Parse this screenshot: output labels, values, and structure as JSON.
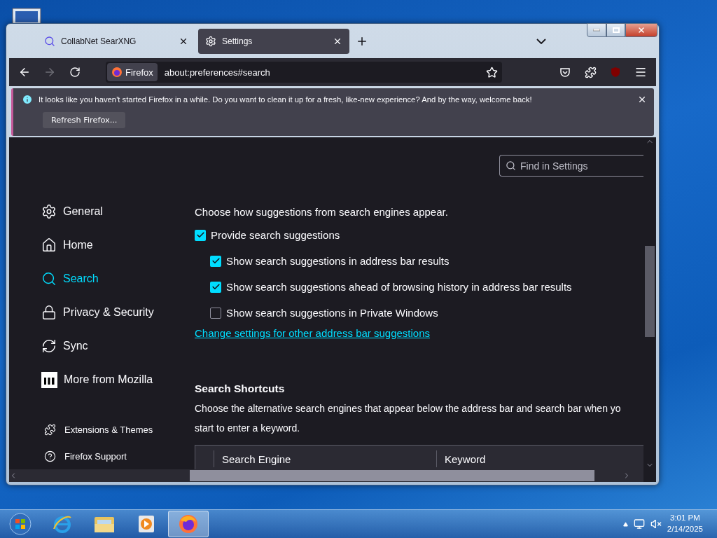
{
  "tabs": [
    {
      "label": "CollabNet SearXNG",
      "selected": false,
      "kind": "search"
    },
    {
      "label": "Settings",
      "selected": true,
      "kind": "settings"
    }
  ],
  "toolbar": {
    "identity": "Firefox",
    "url": "about:preferences#search"
  },
  "notification": {
    "message": "It looks like you haven't started Firefox in a while. Do you want to clean it up for a fresh, like-new experience? And by the way, welcome back!",
    "button": "Refresh Firefox..."
  },
  "search_field": {
    "placeholder": "Find in Settings"
  },
  "sidebar": {
    "items": [
      {
        "label": "General",
        "selected": false,
        "kind": "general"
      },
      {
        "label": "Home",
        "selected": false,
        "kind": "home"
      },
      {
        "label": "Search",
        "selected": true,
        "kind": "search"
      },
      {
        "label": "Privacy & Security",
        "selected": false,
        "kind": "privacy"
      },
      {
        "label": "Sync",
        "selected": false,
        "kind": "sync"
      },
      {
        "label": "More from Mozilla",
        "selected": false,
        "kind": "mozilla"
      }
    ],
    "footer": [
      {
        "label": "Extensions & Themes",
        "kind": "extensions"
      },
      {
        "label": "Firefox Support",
        "kind": "support"
      }
    ]
  },
  "suggestions": {
    "description": "Choose how suggestions from search engines appear.",
    "options": [
      {
        "label": "Provide search suggestions",
        "checked": true,
        "children": [
          {
            "label": "Show search suggestions in address bar results",
            "checked": true
          },
          {
            "label": "Show search suggestions ahead of browsing history in address bar results",
            "checked": true
          },
          {
            "label": "Show search suggestions in Private Windows",
            "checked": false
          }
        ]
      }
    ],
    "link": "Change settings for other address bar suggestions"
  },
  "shortcuts": {
    "title": "Search Shortcuts",
    "description_lines": [
      "Choose the alternative search engines that appear below the address bar and search bar when yo",
      "start to enter a keyword."
    ],
    "table": {
      "columns": [
        "Search Engine",
        "Keyword"
      ]
    }
  },
  "taskbar": {
    "items": [
      {
        "kind": "ie",
        "selected": false
      },
      {
        "kind": "explorer",
        "selected": false
      },
      {
        "kind": "media",
        "selected": false
      },
      {
        "kind": "firefox",
        "selected": true
      }
    ],
    "time": "3:01 PM",
    "date": "2/14/2025"
  }
}
